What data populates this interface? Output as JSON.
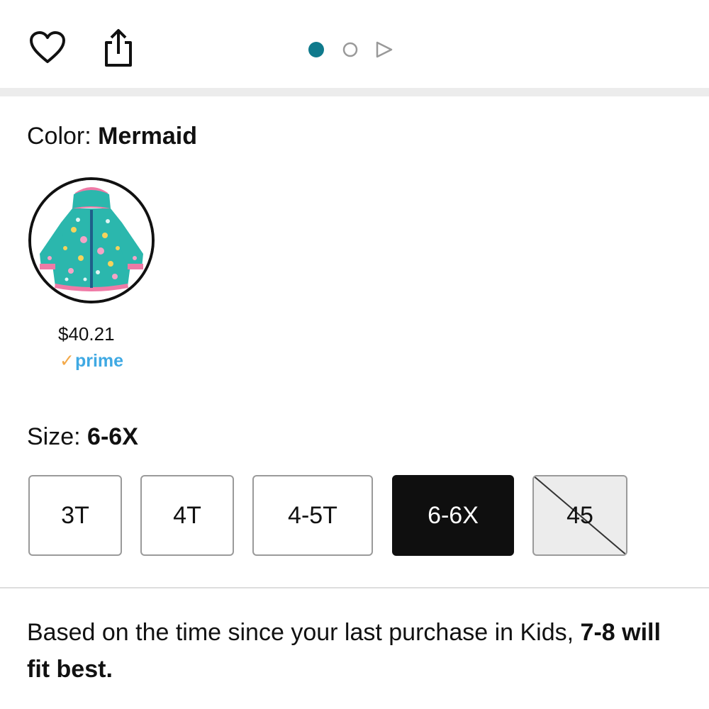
{
  "header": {
    "icons": [
      "heart-icon",
      "share-icon"
    ],
    "carousel": {
      "active_index": 0,
      "dot_count": 2,
      "has_video": true,
      "accent_color": "#0f7a8c"
    }
  },
  "color": {
    "label": "Color: ",
    "value": "Mermaid",
    "swatch": {
      "price": "$40.21",
      "prime_check": "✓",
      "prime_label": "prime"
    }
  },
  "size": {
    "label": "Size: ",
    "value": "6-6X",
    "options": [
      {
        "label": "3T",
        "state": "available"
      },
      {
        "label": "4T",
        "state": "available"
      },
      {
        "label": "4-5T",
        "state": "available"
      },
      {
        "label": "6-6X",
        "state": "selected"
      },
      {
        "label": "45",
        "state": "unavailable"
      }
    ]
  },
  "fit_note": {
    "text": "Based on the time since your last purchase in Kids, ",
    "bold": "7-8 will fit best."
  },
  "colors": {
    "brand_prime": "#3fa9e3",
    "prime_check": "#f3a847",
    "selected_bg": "#0f0f0f"
  }
}
